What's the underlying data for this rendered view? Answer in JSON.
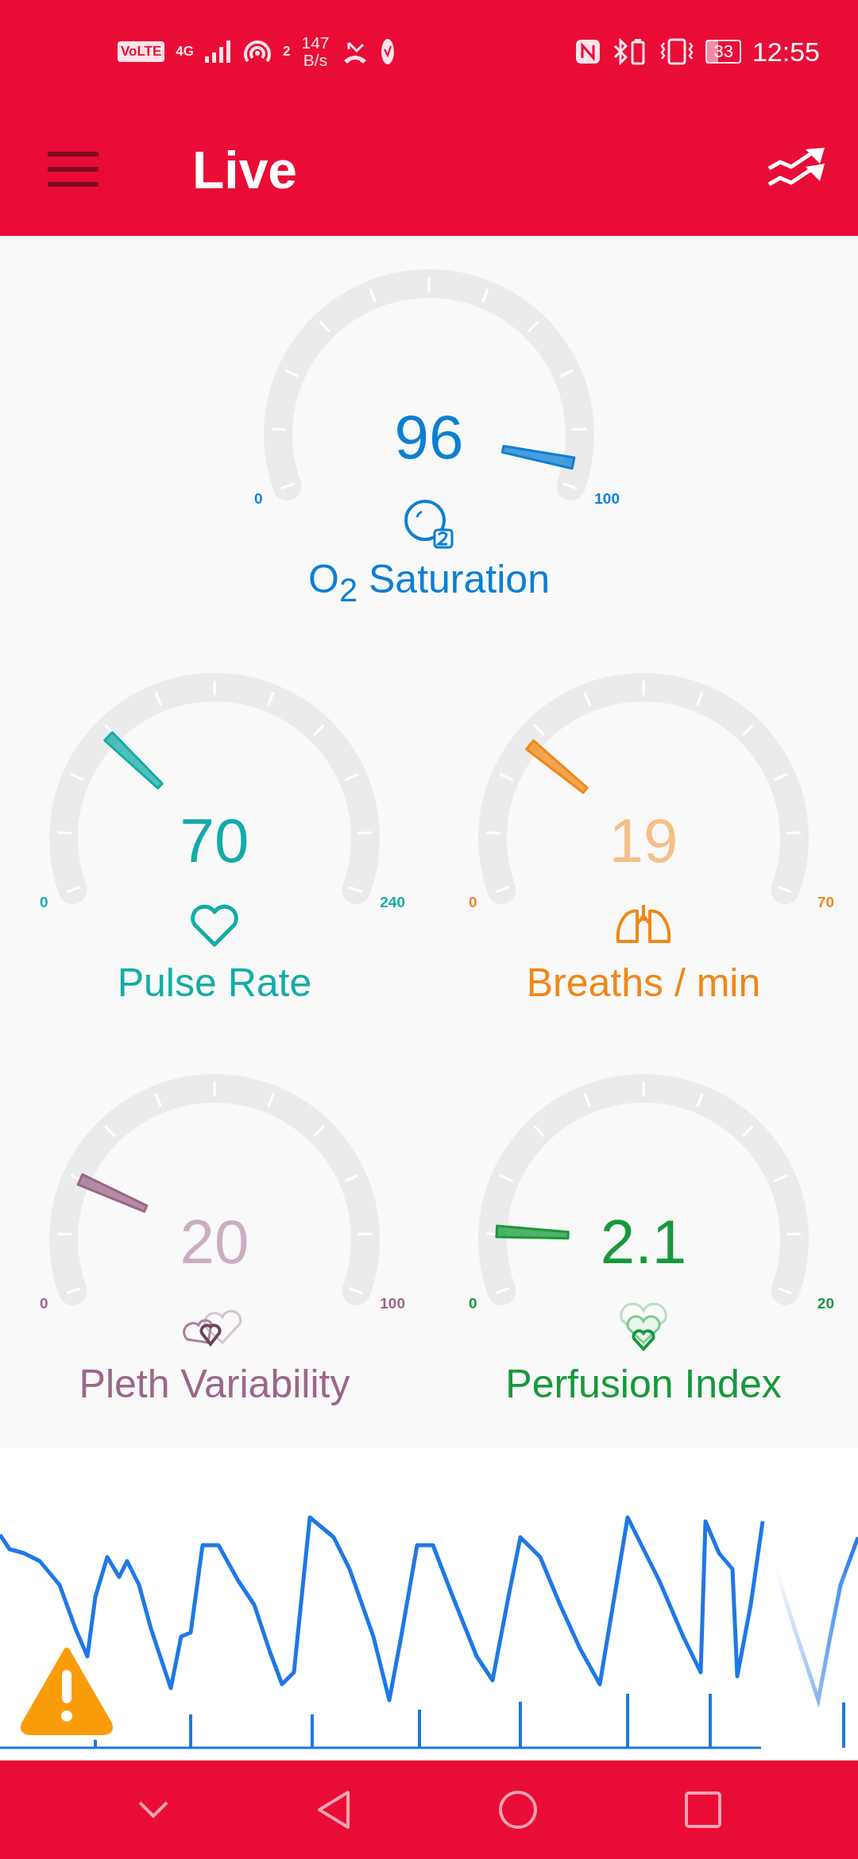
{
  "status_bar": {
    "volte": "VoLTE",
    "network": "4G",
    "hotspot_count": "2",
    "speed": "147",
    "speed_unit": "B/s",
    "battery": "33",
    "time": "12:55"
  },
  "app_bar": {
    "title": "Live"
  },
  "gauges": [
    {
      "kind": "oxygen",
      "value": "96",
      "min": "0",
      "max": "100",
      "label": "O$_{2}$ Saturation",
      "color": "#0b7fd4"
    },
    {
      "kind": "heart",
      "value": "70",
      "min": "0",
      "max": "240",
      "label": "Pulse Rate",
      "color": "#13aca8"
    },
    {
      "kind": "lungs",
      "value": "19",
      "min": "0",
      "max": "70",
      "label": "Breaths / min",
      "color": "#f08718"
    },
    {
      "kind": "pleth",
      "value": "20",
      "min": "0",
      "max": "100",
      "label": "Pleth Variability",
      "color": "#9c6689"
    },
    {
      "kind": "perfusion",
      "value": "2.1",
      "min": "0",
      "max": "20",
      "label": "Perfusion Index",
      "color": "#17993a"
    }
  ],
  "waveform": {
    "warning": true
  }
}
